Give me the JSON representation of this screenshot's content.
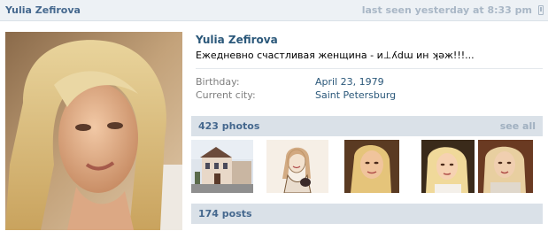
{
  "header": {
    "name": "Yulia Zefirova",
    "last_seen": "last seen yesterday at 8:33 pm",
    "device_icon": "mobile-phone-icon"
  },
  "profile": {
    "full_name": "Yulia Zefirova",
    "status": "Ежедневно счастливая женщина - и⊥ʎdɯ ин ʞəж!!!...",
    "fields": [
      {
        "label": "Birthday:",
        "value": "April 23, 1979"
      },
      {
        "label": "Current city:",
        "value": "Saint Petersburg"
      }
    ]
  },
  "photos_section": {
    "title": "423 photos",
    "see_all": "see all",
    "thumbnails": [
      "old-building",
      "pencil-drawing",
      "portrait",
      "portrait",
      "portrait"
    ]
  },
  "posts_section": {
    "title": "174 posts"
  },
  "colors": {
    "header_bg": "#edf1f5",
    "section_bg": "#dae1e8",
    "name_blue": "#2b587a",
    "link_blue": "#45688e"
  }
}
